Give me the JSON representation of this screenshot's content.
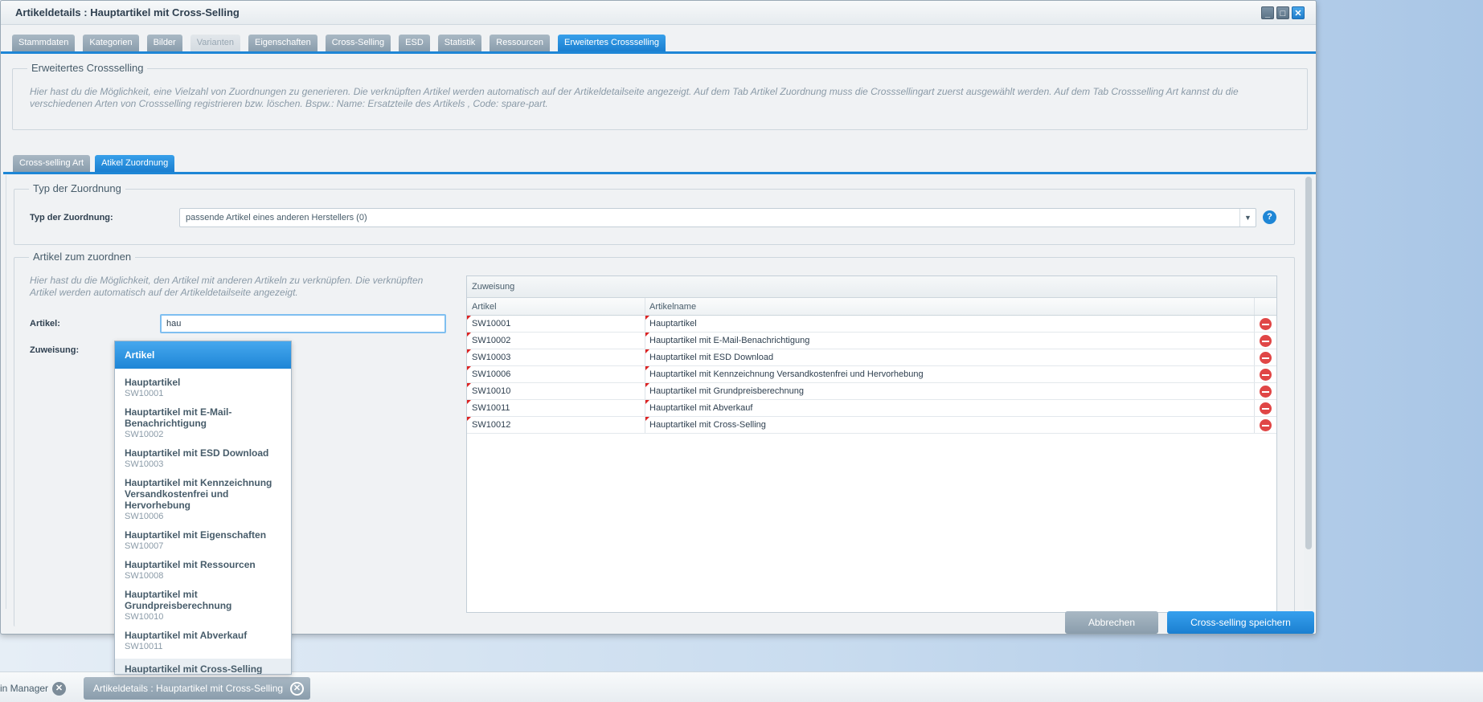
{
  "window": {
    "title": "Artikeldetails : Hauptartikel mit Cross-Selling",
    "controls": [
      "_",
      "□",
      "✕"
    ]
  },
  "tabs": [
    {
      "label": "Stammdaten",
      "state": "normal"
    },
    {
      "label": "Kategorien",
      "state": "normal"
    },
    {
      "label": "Bilder",
      "state": "normal"
    },
    {
      "label": "Varianten",
      "state": "disabled"
    },
    {
      "label": "Eigenschaften",
      "state": "normal"
    },
    {
      "label": "Cross-Selling",
      "state": "normal"
    },
    {
      "label": "ESD",
      "state": "normal"
    },
    {
      "label": "Statistik",
      "state": "normal"
    },
    {
      "label": "Ressourcen",
      "state": "normal"
    },
    {
      "label": "Erweitertes Crossselling",
      "state": "active"
    }
  ],
  "info": {
    "legend": "Erweitertes Crossselling",
    "text": "Hier hast du die Möglichkeit, eine Vielzahl von Zuordnungen zu generieren. Die verknüpften Artikel werden automatisch auf der Artikeldetailseite angezeigt. Auf dem Tab Artikel Zuordnung muss die Crosssellingart zuerst ausgewählt werden. Auf dem Tab Crossselling Art kannst du die verschiedenen Arten von Crossselling registrieren bzw. löschen. Bspw.: Name: Ersatzteile des Artikels , Code: spare-part."
  },
  "subtabs": [
    {
      "label": "Cross-selling Art",
      "state": "normal"
    },
    {
      "label": "Atikel Zuordnung",
      "state": "active"
    }
  ],
  "type_section": {
    "legend": "Typ der Zuordnung",
    "label": "Typ der Zuordnung:",
    "value": "passende Artikel eines anderen Herstellers  (0)",
    "help": "?"
  },
  "assign_section": {
    "legend": "Artikel zum zuordnen",
    "text": "Hier hast du die Möglichkeit, den Artikel mit anderen Artikeln zu verknüpfen. Die verknüpften Artikel werden automatisch auf der Artikeldetailseite angezeigt.",
    "artikel_label": "Artikel:",
    "artikel_value": "hau",
    "zuweisung_label": "Zuweisung:"
  },
  "grid": {
    "title": "Zuweisung",
    "columns": [
      "Artikel",
      "Artikelname"
    ],
    "rows": [
      {
        "code": "SW10001",
        "name": "Hauptartikel"
      },
      {
        "code": "SW10002",
        "name": "Hauptartikel mit E-Mail-Benachrichtigung"
      },
      {
        "code": "SW10003",
        "name": "Hauptartikel mit ESD Download"
      },
      {
        "code": "SW10006",
        "name": "Hauptartikel mit Kennzeichnung Versandkostenfrei und Hervorhebung"
      },
      {
        "code": "SW10010",
        "name": "Hauptartikel mit Grundpreisberechnung"
      },
      {
        "code": "SW10011",
        "name": "Hauptartikel mit Abverkauf"
      },
      {
        "code": "SW10012",
        "name": "Hauptartikel mit Cross-Selling"
      }
    ]
  },
  "popup": {
    "header": "Artikel",
    "items": [
      {
        "name": "Hauptartikel",
        "code": "SW10001"
      },
      {
        "name": "Hauptartikel mit E-Mail-Benachrichtigung",
        "code": "SW10002"
      },
      {
        "name": "Hauptartikel mit ESD Download",
        "code": "SW10003"
      },
      {
        "name": "Hauptartikel mit Kennzeichnung Versandkostenfrei und Hervorhebung",
        "code": "SW10006"
      },
      {
        "name": "Hauptartikel mit Eigenschaften",
        "code": "SW10007"
      },
      {
        "name": "Hauptartikel mit Ressourcen",
        "code": "SW10008"
      },
      {
        "name": "Hauptartikel mit Grundpreisberechnung",
        "code": "SW10010"
      },
      {
        "name": "Hauptartikel mit Abverkauf",
        "code": "SW10011"
      },
      {
        "name": "Hauptartikel mit Cross-Selling",
        "code": ""
      }
    ]
  },
  "buttons": {
    "cancel": "Abbrechen",
    "save": "Cross-selling speichern"
  },
  "taskbar": [
    {
      "label": "in Manager"
    },
    {
      "label": "Artikeldetails : Hauptartikel mit Cross-Selling"
    }
  ]
}
